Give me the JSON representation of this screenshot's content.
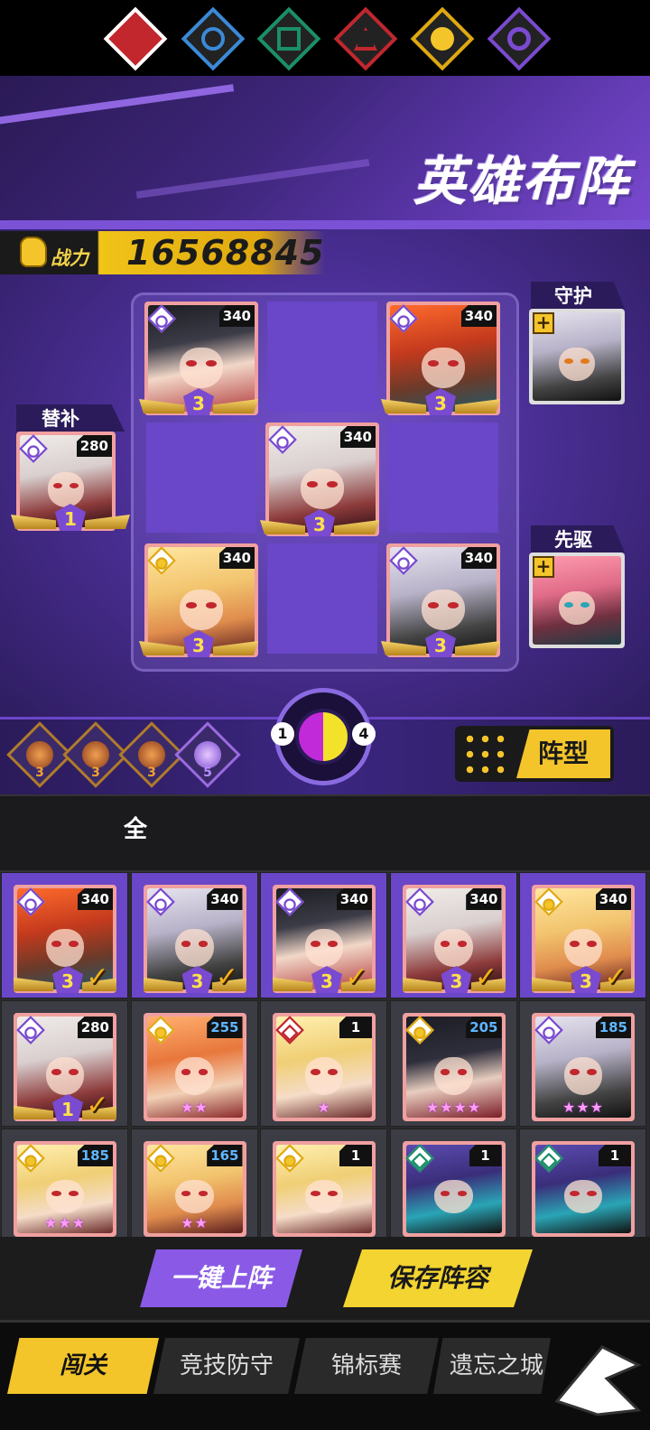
{
  "title": "英雄布阵",
  "power": {
    "label": "战力",
    "value": "16568845"
  },
  "side_labels": {
    "substitute": "替补",
    "guard": "守护",
    "vanguard": "先驱"
  },
  "board": [
    {
      "pos": "top-left",
      "level": "340",
      "stars": "3",
      "faction": "void",
      "hair": "hair-black"
    },
    {
      "pos": "top-right",
      "level": "340",
      "stars": "3",
      "faction": "void",
      "hair": "hair-red"
    },
    {
      "pos": "middle",
      "level": "340",
      "stars": "3",
      "faction": "void",
      "hair": "hair-white"
    },
    {
      "pos": "bottom-left",
      "level": "340",
      "stars": "3",
      "faction": "sun",
      "hair": "hair-gold"
    },
    {
      "pos": "bottom-right",
      "level": "340",
      "stars": "3",
      "faction": "void",
      "hair": "hair-grey"
    }
  ],
  "substitute": {
    "level": "280",
    "stars": "1",
    "faction": "void",
    "hair": "hair-white"
  },
  "runes": [
    {
      "lv": "3"
    },
    {
      "lv": "3"
    },
    {
      "lv": "3"
    },
    {
      "lv": "5"
    }
  ],
  "wheel": {
    "left": "1",
    "right": "4"
  },
  "formation_label": "阵型",
  "filter_all_label": "全",
  "roster": [
    {
      "level": "340",
      "badge": "3",
      "check": "✓",
      "faction": "void",
      "hair": "hair-red",
      "sel": true
    },
    {
      "level": "340",
      "badge": "3",
      "check": "✓",
      "faction": "void",
      "hair": "hair-grey",
      "sel": true
    },
    {
      "level": "340",
      "badge": "3",
      "check": "✓",
      "faction": "void",
      "hair": "hair-black",
      "sel": true
    },
    {
      "level": "340",
      "badge": "3",
      "check": "✓",
      "faction": "void",
      "hair": "hair-white",
      "sel": true
    },
    {
      "level": "340",
      "badge": "3",
      "check": "✓",
      "faction": "sun",
      "hair": "hair-gold",
      "sel": true
    },
    {
      "level": "280",
      "badge": "1",
      "check": "✓",
      "faction": "void",
      "hair": "hair-white",
      "sel": false
    },
    {
      "level": "255",
      "stars": "★★",
      "faction": "sun",
      "hair": "hair-orange",
      "sel": false
    },
    {
      "level": "1",
      "stars": "★",
      "faction": "tri",
      "hair": "hair-blonde",
      "sel": false
    },
    {
      "level": "205",
      "stars": "★★★★",
      "faction": "sun",
      "hair": "hair-dark",
      "sel": false
    },
    {
      "level": "185",
      "stars": "★★★",
      "faction": "void",
      "hair": "hair-grey",
      "sel": false
    },
    {
      "level": "185",
      "stars": "★★★",
      "faction": "sun",
      "hair": "hair-blonde",
      "sel": false
    },
    {
      "level": "165",
      "stars": "★★",
      "faction": "sun",
      "hair": "hair-gold",
      "sel": false
    },
    {
      "level": "1",
      "stars": "",
      "faction": "sun",
      "hair": "hair-blonde",
      "sel": false
    },
    {
      "level": "1",
      "stars": "",
      "faction": "tree",
      "hair": "hair-purple",
      "sel": false
    },
    {
      "level": "1",
      "stars": "",
      "faction": "tree",
      "hair": "hair-purple",
      "sel": false
    }
  ],
  "actions": {
    "auto": "一键上阵",
    "save": "保存阵容"
  },
  "tabs": [
    "闯关",
    "竞技防守",
    "锦标赛",
    "遗忘之城"
  ],
  "colors": {
    "accent": "#7a4ad0",
    "gold": "#f3c52a",
    "pink": "#f0a0a0"
  }
}
